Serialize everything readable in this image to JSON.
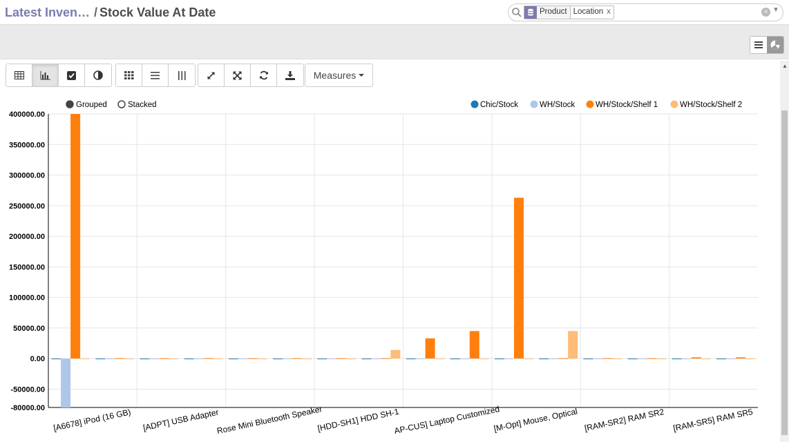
{
  "breadcrumb": {
    "parent": "Latest Inven…",
    "current": "Stock Value At Date"
  },
  "search": {
    "facet_field": "Product",
    "facet_value": "Location",
    "facet_remove": "x"
  },
  "measures_label": "Measures",
  "chart_data": {
    "type": "bar",
    "modes": [
      "Grouped",
      "Stacked"
    ],
    "selected_mode": "Grouped",
    "legend_position": "top-right",
    "grid": true,
    "categories": [
      "[A6678] iPod (16 GB)",
      "[ADPT] USB Adapter",
      "[BOSE] Bose Mini Bluetooth Speaker",
      "[HDD-SH1] HDD SH-1",
      "[LAP-CUS] Laptop Customized",
      "[M-Opt] Mouse, Optical",
      "[RAM-SR2] RAM SR2",
      "[RAM-SR5] RAM SR5"
    ],
    "categories_shown": [
      "[A6678] iPod (16 GB)",
      "[ADPT] USB Adapter",
      "Rose Mini Bluetooth Speaker",
      "[HDD-SH1] HDD SH-1",
      "AP-CUS] Laptop Customized",
      "[M-Opt] Mouse, Optical",
      "[RAM-SR2] RAM SR2",
      "[RAM-SR5] RAM SR5"
    ],
    "series": [
      {
        "name": "Chic/Stock",
        "color": "#1f77b4",
        "values": [
          0,
          0,
          0,
          0,
          0,
          0,
          0,
          0,
          0,
          0,
          0,
          0,
          0,
          0,
          0,
          0
        ]
      },
      {
        "name": "WH/Stock",
        "color": "#aec7e8",
        "values": [
          -80000,
          0,
          0,
          0,
          0,
          0,
          0,
          0,
          0,
          0,
          0,
          0,
          0,
          0,
          0,
          0
        ]
      },
      {
        "name": "WH/Stock/Shelf 1",
        "color": "#ff7f0e",
        "values": [
          400000,
          500,
          500,
          500,
          500,
          500,
          500,
          500,
          33000,
          45000,
          263000,
          500,
          500,
          500,
          2000,
          2000
        ]
      },
      {
        "name": "WH/Stock/Shelf 2",
        "color": "#ffbb78",
        "values": [
          0,
          0,
          0,
          0,
          0,
          0,
          0,
          14000,
          0,
          0,
          0,
          45000,
          0,
          0,
          0,
          0
        ]
      }
    ],
    "y_ticks": [
      "400000.00",
      "350000.00",
      "300000.00",
      "250000.00",
      "200000.00",
      "150000.00",
      "100000.00",
      "50000.00",
      "0.00",
      "-50000.00",
      "-80000.00"
    ],
    "ylim": [
      -80000,
      400000
    ]
  },
  "colors": {
    "accent": "#7c7bad"
  },
  "icons": {
    "search": "search-icon",
    "facet": "database-icon",
    "pivot": "table-icon",
    "graph": "bar-chart-icon",
    "list": "list-icon",
    "pie": "pie-chart-icon"
  }
}
